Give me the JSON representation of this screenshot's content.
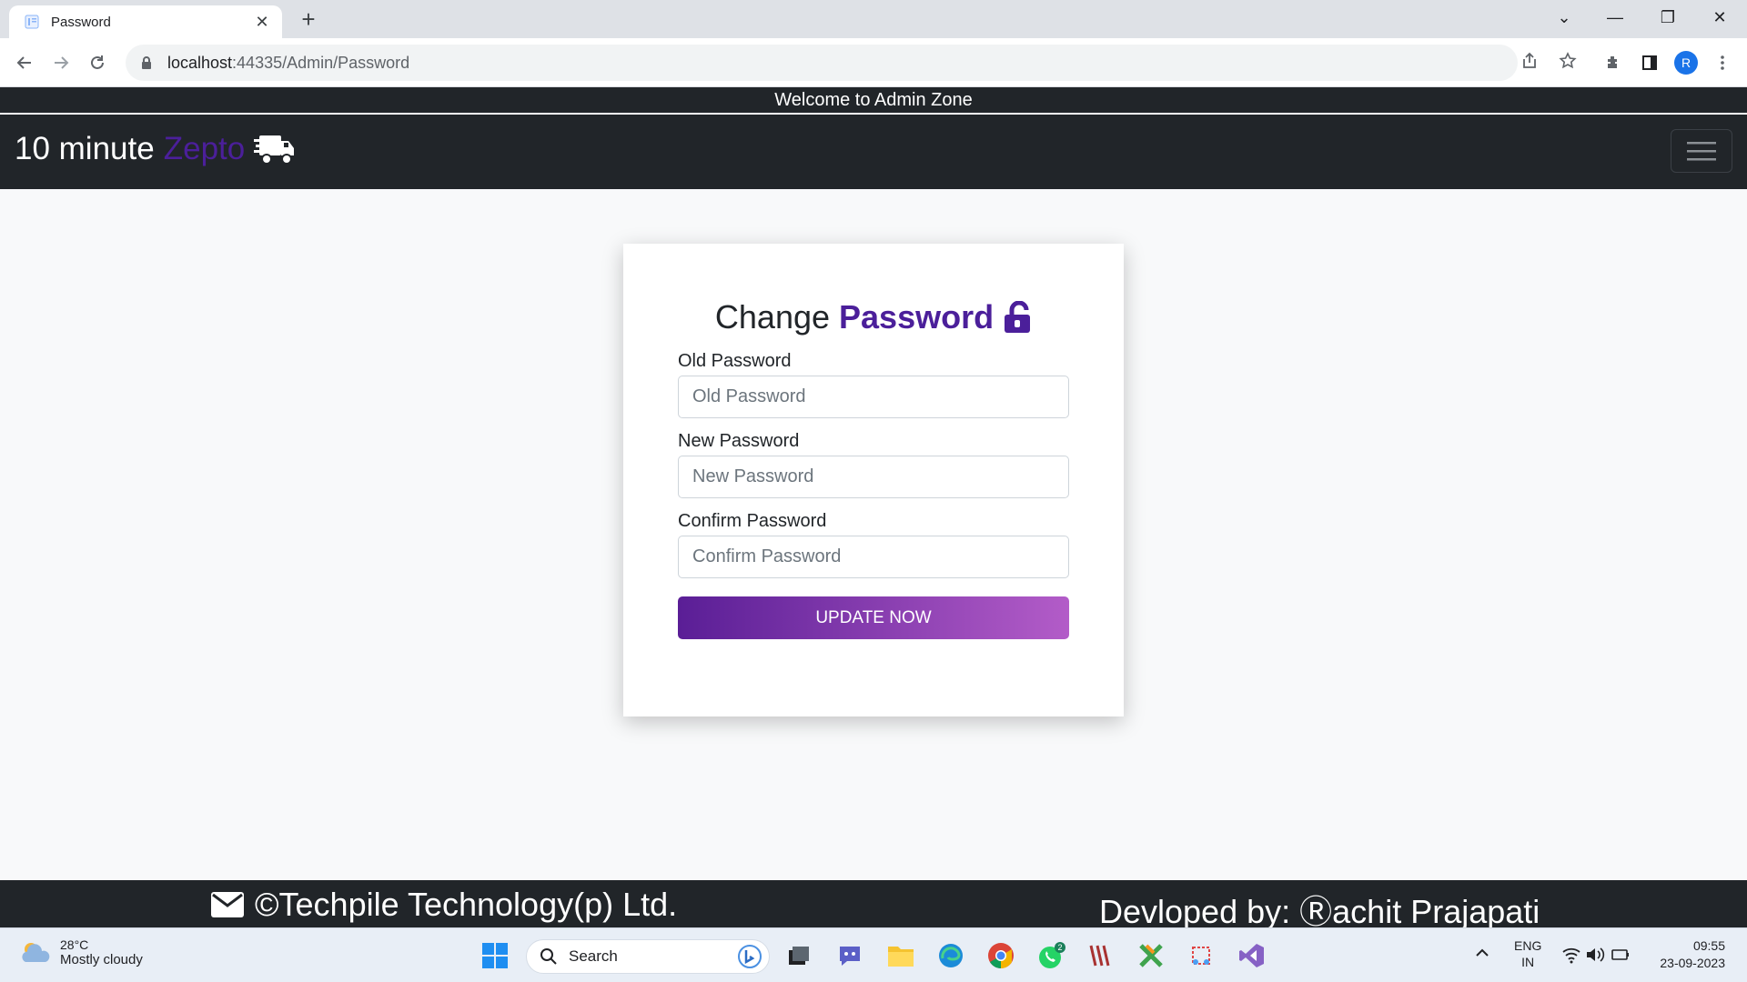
{
  "browser": {
    "tab_title": "Password",
    "url_host": "localhost",
    "url_rest": ":44335/Admin/Password",
    "profile_initial": "R"
  },
  "site": {
    "welcome": "Welcome to Admin Zone",
    "brand_main": "10 minute",
    "brand_accent": "Zepto",
    "accent_color": "#4b1f9a"
  },
  "form": {
    "title_main": "Change",
    "title_accent": "Password",
    "fields": [
      {
        "label": "Old Password",
        "placeholder": "Old Password"
      },
      {
        "label": "New Password",
        "placeholder": "New Password"
      },
      {
        "label": "Confirm Password",
        "placeholder": "Confirm Password"
      }
    ],
    "submit_label": "UPDATE NOW"
  },
  "footer": {
    "copyright": "©Techpile Technology(p) Ltd.",
    "developer_prefix": "Devloped by: ",
    "developer_r": "Ⓡ",
    "developer_rest": "achit Prajapati"
  },
  "taskbar": {
    "temperature": "28°C",
    "condition": "Mostly cloudy",
    "search_label": "Search",
    "whatsapp_badge": "2",
    "lang_top": "ENG",
    "lang_bottom": "IN",
    "time": "09:55",
    "date": "23-09-2023"
  }
}
